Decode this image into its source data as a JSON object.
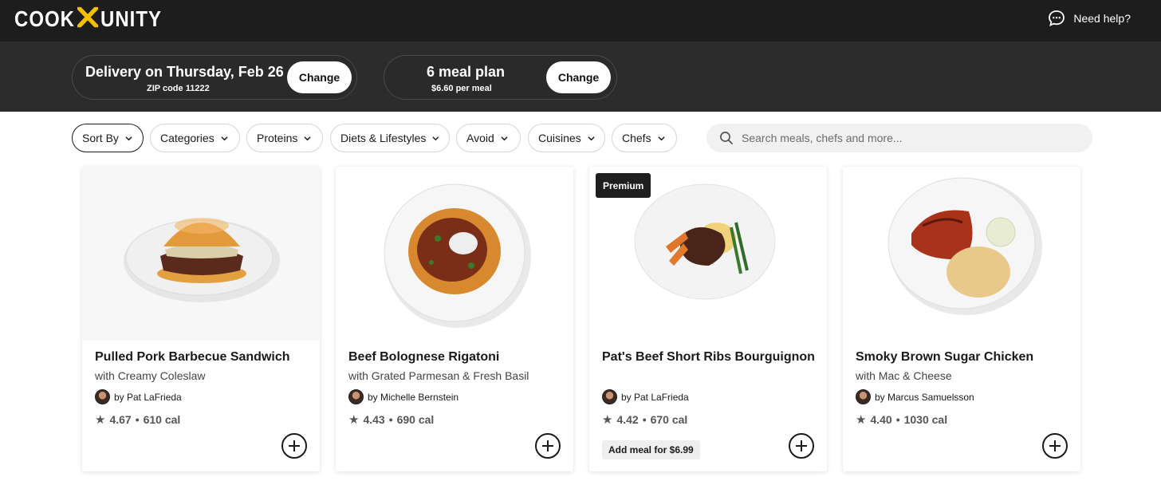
{
  "header": {
    "logo_left": "COOK",
    "logo_right": "UNITY",
    "help_label": "Need help?"
  },
  "delivery": {
    "title": "Delivery on Thursday, Feb 26",
    "zip": "ZIP code 11222",
    "change_label": "Change"
  },
  "plan": {
    "title": "6 meal plan",
    "price": "$6.60 per meal",
    "change_label": "Change"
  },
  "filters": {
    "sort_by": "Sort By",
    "categories": "Categories",
    "proteins": "Proteins",
    "diets": "Diets & Lifestyles",
    "avoid": "Avoid",
    "cuisines": "Cuisines",
    "chefs": "Chefs"
  },
  "search": {
    "placeholder": "Search meals, chefs and more..."
  },
  "meals": [
    {
      "title": "Pulled Pork Barbecue Sandwich",
      "subtitle": "with Creamy Coleslaw",
      "chef": "by Pat LaFrieda",
      "rating": "4.67",
      "calories": "610 cal"
    },
    {
      "title": "Beef Bolognese Rigatoni",
      "subtitle": "with Grated Parmesan & Fresh Basil",
      "chef": "by Michelle Bernstein",
      "rating": "4.43",
      "calories": "690 cal"
    },
    {
      "title": "Pat's Beef Short Ribs Bourguignon",
      "subtitle": "",
      "chef": "by Pat LaFrieda",
      "rating": "4.42",
      "calories": "670 cal",
      "badge": "Premium",
      "add_meal": "Add meal for $6.99"
    },
    {
      "title": "Smoky Brown Sugar Chicken",
      "subtitle": "with Mac & Cheese",
      "chef": "by Marcus Samuelsson",
      "rating": "4.40",
      "calories": "1030 cal"
    }
  ],
  "rating_separator": "•",
  "colors": {
    "topbar": "#1d1d1d",
    "band": "#2c2c2c",
    "accent_logo_x": "#f5c000",
    "badge": "#1f1f1f"
  }
}
